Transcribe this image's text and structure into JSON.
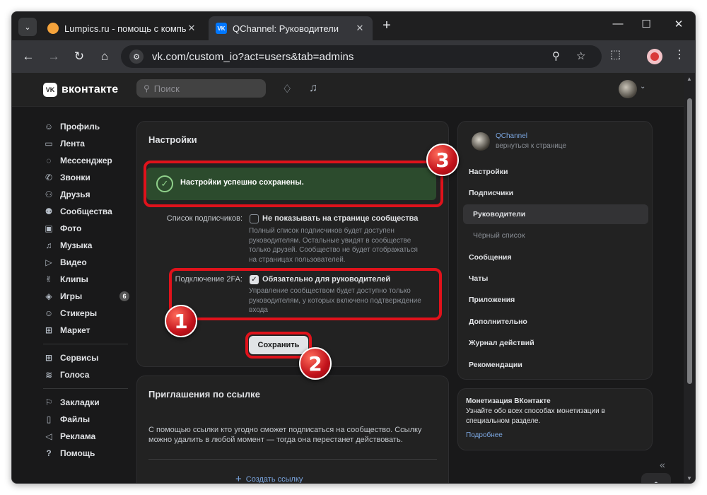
{
  "browser": {
    "tabs": [
      {
        "title": "Lumpics.ru - помощь с компьютером",
        "active": false
      },
      {
        "title": "QChannel: Руководители",
        "active": true
      }
    ],
    "new_tab": "+",
    "url": "vk.com/custom_io?act=users&tab=admins"
  },
  "vk": {
    "logo_text": "вконтакте",
    "search_placeholder": "Поиск",
    "nav": [
      {
        "label": "Профиль",
        "icon": "user-icon",
        "glyph": "☺"
      },
      {
        "label": "Лента",
        "icon": "news-icon",
        "glyph": "▭"
      },
      {
        "label": "Мессенджер",
        "icon": "message-icon",
        "glyph": "◌"
      },
      {
        "label": "Звонки",
        "icon": "phone-icon",
        "glyph": "✆"
      },
      {
        "label": "Друзья",
        "icon": "friends-icon",
        "glyph": "⚇"
      },
      {
        "label": "Сообщества",
        "icon": "groups-icon",
        "glyph": "⚉"
      },
      {
        "label": "Фото",
        "icon": "photo-icon",
        "glyph": "▣"
      },
      {
        "label": "Музыка",
        "icon": "music-icon",
        "glyph": "♫"
      },
      {
        "label": "Видео",
        "icon": "video-icon",
        "glyph": "▷"
      },
      {
        "label": "Клипы",
        "icon": "clips-icon",
        "glyph": "✌"
      },
      {
        "label": "Игры",
        "icon": "gamepad-icon",
        "glyph": "◈",
        "badge": "6"
      },
      {
        "label": "Стикеры",
        "icon": "sticker-icon",
        "glyph": "☺"
      },
      {
        "label": "Маркет",
        "icon": "market-icon",
        "glyph": "⊞"
      }
    ],
    "nav2": [
      {
        "label": "Сервисы",
        "icon": "services-icon",
        "glyph": "⊞"
      },
      {
        "label": "Голоса",
        "icon": "votes-icon",
        "glyph": "≋"
      }
    ],
    "nav3": [
      {
        "label": "Закладки",
        "icon": "bookmark-icon",
        "glyph": "⚐"
      },
      {
        "label": "Файлы",
        "icon": "file-icon",
        "glyph": "▯"
      },
      {
        "label": "Реклама",
        "icon": "megaphone-icon",
        "glyph": "◁"
      },
      {
        "label": "Помощь",
        "icon": "help-icon",
        "glyph": "?"
      }
    ]
  },
  "settings": {
    "title": "Настройки",
    "success_message": "Настройки успешно сохранены.",
    "subscribers": {
      "label": "Список подписчиков:",
      "checkbox_label": "Не показывать на странице сообщества",
      "checked": false,
      "hint": "Полный список подписчиков будет доступен руководителям. Остальные увидят в сообществе только друзей. Сообщество не будет отображаться на страницах пользователей."
    },
    "twofa": {
      "label": "Подключение 2FA:",
      "checkbox_label": "Обязательно для руководителей",
      "checked": true,
      "hint": "Управление сообществом будет доступно только руководителям, у которых включено подтверждение входа"
    },
    "save_label": "Сохранить"
  },
  "invites": {
    "title": "Приглашения по ссылке",
    "description": "С помощью ссылки кто угодно сможет подписаться на сообщество. Ссылку можно удалить в любой момент — тогда она перестанет действовать.",
    "create_label": "Создать ссылку"
  },
  "right_panel": {
    "community_name": "QChannel",
    "back_label": "вернуться к странице",
    "menu": [
      {
        "label": "Настройки",
        "sub": false,
        "active": false
      },
      {
        "label": "Подписчики",
        "sub": false,
        "active": false
      },
      {
        "label": "Руководители",
        "sub": true,
        "active": true
      },
      {
        "label": "Чёрный список",
        "sub": true,
        "active": false
      },
      {
        "label": "Сообщения",
        "sub": false,
        "active": false
      },
      {
        "label": "Чаты",
        "sub": false,
        "active": false
      },
      {
        "label": "Приложения",
        "sub": false,
        "active": false
      },
      {
        "label": "Дополнительно",
        "sub": false,
        "active": false
      },
      {
        "label": "Журнал действий",
        "sub": false,
        "active": false
      },
      {
        "label": "Рекомендации",
        "sub": false,
        "active": false
      }
    ],
    "monetization": {
      "title": "Монетизация ВКонтакте",
      "text": "Узнайте обо всех способах монетизации в специальном разделе.",
      "link": "Подробнее"
    }
  },
  "annotations": {
    "markers": [
      "1",
      "2",
      "3"
    ],
    "color": "#e0121b"
  }
}
